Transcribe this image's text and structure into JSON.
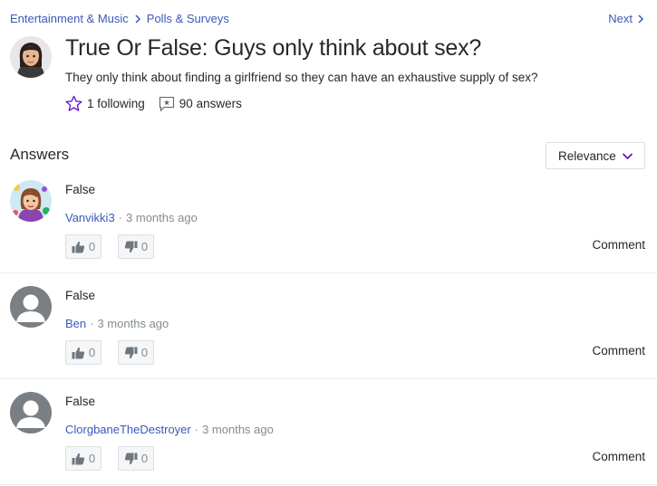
{
  "breadcrumb": {
    "category": "Entertainment & Music",
    "subcategory": "Polls & Surveys"
  },
  "nav": {
    "next_label": "Next"
  },
  "question": {
    "title": "True Or False: Guys only think about sex?",
    "body": "They only think about finding a girlfriend so they can have an exhaustive supply of sex?",
    "following": "1 following",
    "answers_count": "90 answers"
  },
  "answers_section": {
    "heading": "Answers",
    "sort_label": "Relevance"
  },
  "answers": [
    {
      "text": "False",
      "author": "Vanvikki3",
      "time": "3 months ago",
      "upvotes": "0",
      "downvotes": "0",
      "comment_label": "Comment"
    },
    {
      "text": "False",
      "author": "Ben",
      "time": "3 months ago",
      "upvotes": "0",
      "downvotes": "0",
      "comment_label": "Comment"
    },
    {
      "text": "False",
      "author": "ClorgbaneTheDestroyer",
      "time": "3 months ago",
      "upvotes": "0",
      "downvotes": "0",
      "comment_label": "Comment"
    }
  ],
  "icons": {
    "breadcrumb_sep": "chevron-right-icon",
    "next": "chevron-right-icon",
    "following": "star-outline-icon",
    "answers": "answer-bubble-icon",
    "sort": "chevron-down-icon",
    "upvote": "thumbs-up-icon",
    "downvote": "thumbs-down-icon"
  },
  "colors": {
    "link": "#3c58b8",
    "accent_purple": "#6001d2",
    "muted": "#828c93",
    "text": "#26282a"
  }
}
